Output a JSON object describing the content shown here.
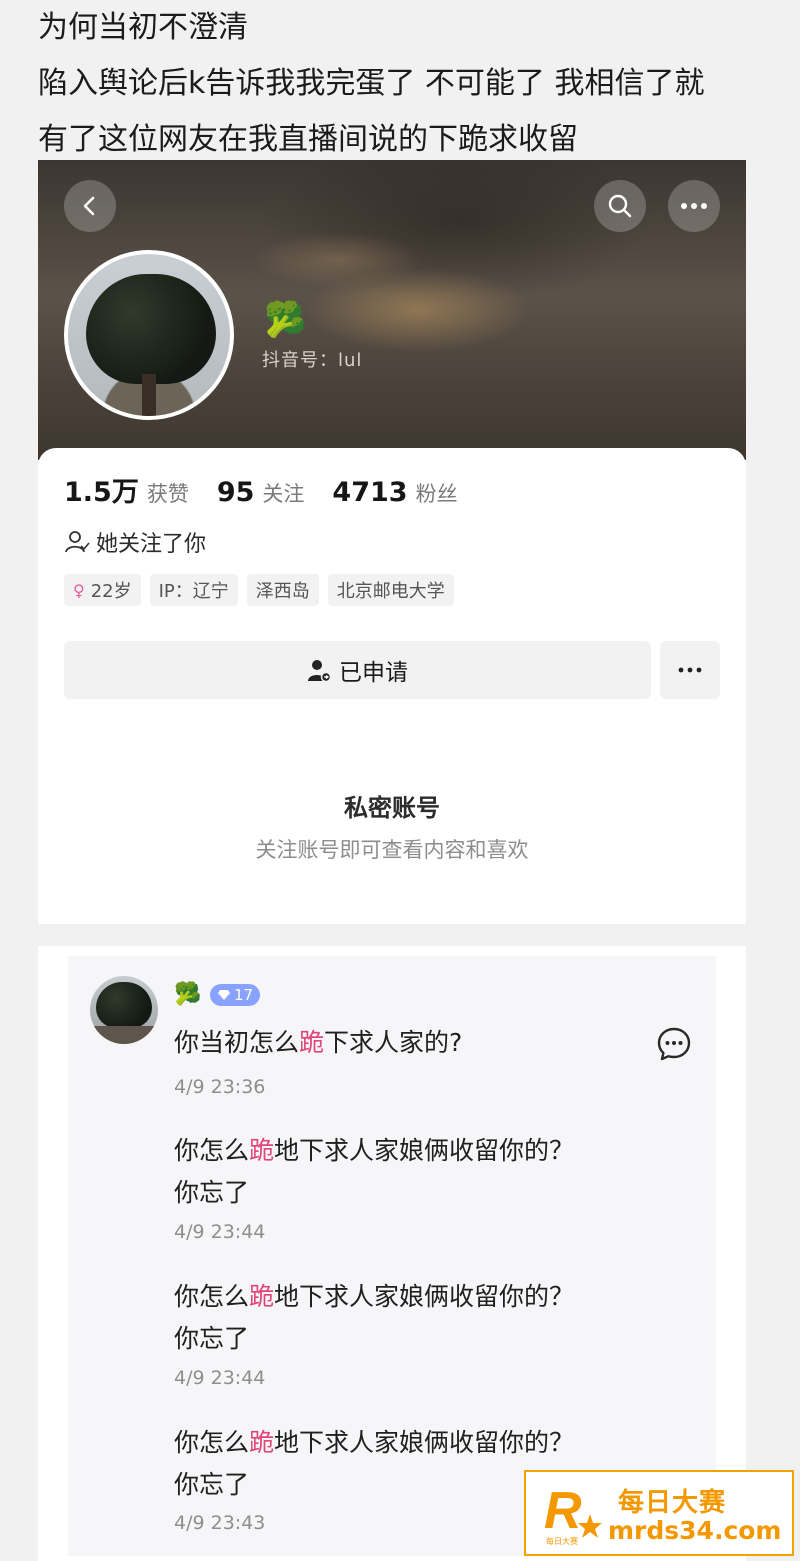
{
  "post": {
    "lines": [
      "为何当初不澄清",
      "陷入舆论后k告诉我我完蛋了 不可能了 我相信了就",
      "有了这位网友在我直播间说的下跪求收留"
    ]
  },
  "profile": {
    "badge_emoji": "🥦",
    "douyin_id": "抖音号：lul",
    "stats": [
      {
        "num": "1.5万",
        "label": "获赞"
      },
      {
        "num": "95",
        "label": "关注"
      },
      {
        "num": "4713",
        "label": "粉丝"
      }
    ],
    "follows_you": "她关注了你",
    "tags": [
      "22岁",
      "IP：辽宁",
      "泽西岛",
      "北京邮电大学"
    ],
    "apply_label": "已申请",
    "private_title": "私密账号",
    "private_sub": "关注账号即可查看内容和喜欢"
  },
  "comments": {
    "badge_emoji": "🥦",
    "level": "17",
    "items": [
      {
        "pre": "你当初怎么",
        "kneel": "跪",
        "post": "下求人家的?",
        "time": "4/9 23:36"
      },
      {
        "pre": "你怎么",
        "kneel": "跪",
        "post": "地下求人家娘俩收留你的？ 你忘了",
        "time": "4/9 23:44"
      },
      {
        "pre": "你怎么",
        "kneel": "跪",
        "post": "地下求人家娘俩收留你的？ 你忘了",
        "time": "4/9 23:44"
      },
      {
        "pre": "你怎么",
        "kneel": "跪",
        "post": "地下求人家娘俩收留你的？ 你忘了",
        "time": "4/9 23:43"
      }
    ]
  },
  "watermark": {
    "cn": "每日大赛",
    "url": "mrds34.com",
    "logo_text": "每日大赛"
  },
  "colors": {
    "accent_pink": "#e0467a",
    "watermark_orange": "#f39800",
    "level_badge": "#8aa2ff"
  }
}
